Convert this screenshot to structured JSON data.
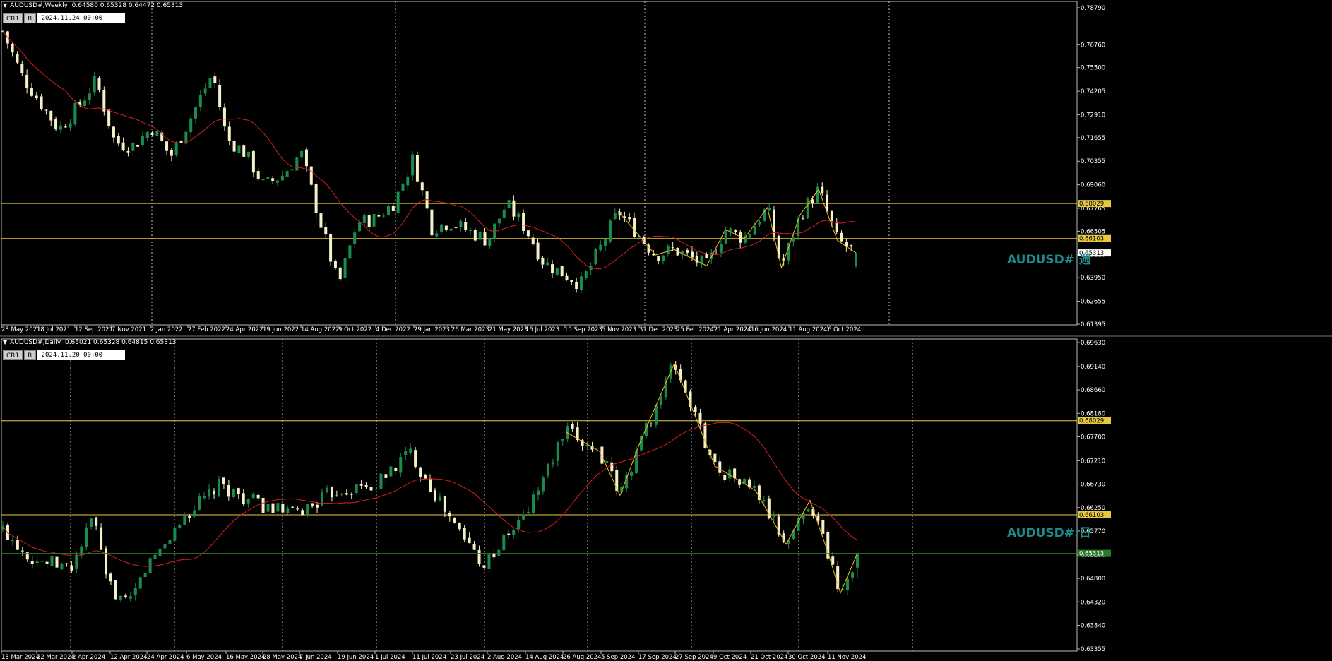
{
  "colors": {
    "background": "#000000",
    "bull_candle": "#1a8c4e",
    "bear_candle": "#f5f0c8",
    "ma_line": "#d42020",
    "zigzag": "#f0c020",
    "level_line": "#e8c840",
    "current_line": "#2a7a2a",
    "grid": "#c8c8c8",
    "watermark": "#1f8a8a"
  },
  "panes": [
    {
      "header": "AUDUSD#,Weekly  0.64580 0.65328 0.64472 0.65313",
      "buttons": [
        "CR1",
        "R"
      ],
      "date_box": "2024.11.24 00:00",
      "watermark": "AUDUSD#:週"
    },
    {
      "header": "AUDUSD#,Daily  0.65021 0.65328 0.64815 0.65313",
      "buttons": [
        "CR1",
        "R"
      ],
      "date_box": "2024.11.20 00:00",
      "watermark": "AUDUSD#:日"
    }
  ],
  "chart_data": [
    {
      "type": "candlestick",
      "timeframe": "Weekly",
      "symbol": "AUDUSD#",
      "ohlc_last": {
        "open": 0.6458,
        "high": 0.65328,
        "low": 0.64472,
        "close": 0.65313
      },
      "ylim": [
        0.61395,
        0.7879
      ],
      "y_ticks": [
        "0.78790",
        "0.76760",
        "0.75500",
        "0.74205",
        "0.72910",
        "0.71655",
        "0.70355",
        "0.69060",
        "0.67765",
        "0.66505",
        "0.65210",
        "0.63950",
        "0.62655",
        "0.61395"
      ],
      "x_ticks": [
        "23 May 2021",
        "18 Jul 2021",
        "12 Sep 2021",
        "7 Nov 2021",
        "2 Jan 2022",
        "27 Feb 2022",
        "24 Apr 2022",
        "19 Jun 2022",
        "14 Aug 2022",
        "9 Oct 2022",
        "4 Dec 2022",
        "29 Jan 2023",
        "26 Mar 2023",
        "21 May 2023",
        "16 Jul 2023",
        "10 Sep 2023",
        "5 Nov 2023",
        "31 Dec 2023",
        "25 Feb 2024",
        "21 Apr 2024",
        "16 Jun 2024",
        "11 Aug 2024",
        "6 Oct 2024"
      ],
      "levels": [
        {
          "label": "0.68029",
          "value": 0.68029
        },
        {
          "label": "0.66103",
          "value": 0.66103
        }
      ],
      "current_price": {
        "label": "0.65313",
        "value": 0.65313
      },
      "close_path": [
        {
          "date": "2021-05-23",
          "value": 0.775
        },
        {
          "date": "2021-06-20",
          "value": 0.751
        },
        {
          "date": "2021-07-18",
          "value": 0.736
        },
        {
          "date": "2021-08-15",
          "value": 0.721
        },
        {
          "date": "2021-09-12",
          "value": 0.733
        },
        {
          "date": "2021-10-10",
          "value": 0.748
        },
        {
          "date": "2021-11-07",
          "value": 0.714
        },
        {
          "date": "2021-12-05",
          "value": 0.712
        },
        {
          "date": "2022-01-02",
          "value": 0.722
        },
        {
          "date": "2022-01-30",
          "value": 0.706
        },
        {
          "date": "2022-02-27",
          "value": 0.726
        },
        {
          "date": "2022-04-03",
          "value": 0.752
        },
        {
          "date": "2022-04-24",
          "value": 0.716
        },
        {
          "date": "2022-05-22",
          "value": 0.708
        },
        {
          "date": "2022-06-19",
          "value": 0.69
        },
        {
          "date": "2022-07-17",
          "value": 0.696
        },
        {
          "date": "2022-08-14",
          "value": 0.708
        },
        {
          "date": "2022-09-11",
          "value": 0.671
        },
        {
          "date": "2022-10-09",
          "value": 0.635
        },
        {
          "date": "2022-11-06",
          "value": 0.67
        },
        {
          "date": "2022-12-04",
          "value": 0.672
        },
        {
          "date": "2023-01-01",
          "value": 0.681
        },
        {
          "date": "2023-01-29",
          "value": 0.705
        },
        {
          "date": "2023-02-26",
          "value": 0.667
        },
        {
          "date": "2023-03-26",
          "value": 0.67
        },
        {
          "date": "2023-04-23",
          "value": 0.665
        },
        {
          "date": "2023-05-21",
          "value": 0.66
        },
        {
          "date": "2023-06-18",
          "value": 0.68
        },
        {
          "date": "2023-07-16",
          "value": 0.667
        },
        {
          "date": "2023-08-13",
          "value": 0.648
        },
        {
          "date": "2023-09-10",
          "value": 0.642
        },
        {
          "date": "2023-10-08",
          "value": 0.636
        },
        {
          "date": "2023-11-05",
          "value": 0.655
        },
        {
          "date": "2023-12-03",
          "value": 0.676
        },
        {
          "date": "2023-12-31",
          "value": 0.664
        },
        {
          "date": "2024-01-28",
          "value": 0.652
        },
        {
          "date": "2024-02-25",
          "value": 0.655
        },
        {
          "date": "2024-04-14",
          "value": 0.646
        },
        {
          "date": "2024-05-12",
          "value": 0.666
        },
        {
          "date": "2024-06-09",
          "value": 0.661
        },
        {
          "date": "2024-07-14",
          "value": 0.678
        },
        {
          "date": "2024-08-04",
          "value": 0.645
        },
        {
          "date": "2024-09-01",
          "value": 0.674
        },
        {
          "date": "2024-09-29",
          "value": 0.688
        },
        {
          "date": "2024-10-27",
          "value": 0.66
        },
        {
          "date": "2024-11-24",
          "value": 0.65313
        }
      ]
    },
    {
      "type": "candlestick",
      "timeframe": "Daily",
      "symbol": "AUDUSD#",
      "ohlc_last": {
        "open": 0.65021,
        "high": 0.65328,
        "low": 0.64815,
        "close": 0.65313
      },
      "ylim": [
        0.63355,
        0.6963
      ],
      "y_ticks": [
        "0.69630",
        "0.69140",
        "0.68660",
        "0.68180",
        "0.67700",
        "0.67210",
        "0.66730",
        "0.66250",
        "0.65770",
        "0.65280",
        "0.64800",
        "0.64320",
        "0.63840",
        "0.63355"
      ],
      "x_ticks": [
        "13 Mar 2024",
        "22 Mar 2024",
        "2 Apr 2024",
        "12 Apr 2024",
        "24 Apr 2024",
        "6 May 2024",
        "16 May 2024",
        "28 May 2024",
        "7 Jun 2024",
        "19 Jun 2024",
        "1 Jul 2024",
        "11 Jul 2024",
        "23 Jul 2024",
        "2 Aug 2024",
        "14 Aug 2024",
        "26 Aug 2024",
        "5 Sep 2024",
        "17 Sep 2024",
        "27 Sep 2024",
        "9 Oct 2024",
        "21 Oct 2024",
        "30 Oct 2024",
        "11 Nov 2024"
      ],
      "levels": [
        {
          "label": "0.68029",
          "value": 0.68029
        },
        {
          "label": "0.66103",
          "value": 0.66103
        }
      ],
      "current_price": {
        "label": "0.65313",
        "value": 0.65313
      },
      "close_path": [
        {
          "date": "2024-03-13",
          "value": 0.658
        },
        {
          "date": "2024-03-22",
          "value": 0.652
        },
        {
          "date": "2024-04-02",
          "value": 0.65
        },
        {
          "date": "2024-04-09",
          "value": 0.661
        },
        {
          "date": "2024-04-12",
          "value": 0.648
        },
        {
          "date": "2024-04-19",
          "value": 0.642
        },
        {
          "date": "2024-04-24",
          "value": 0.65
        },
        {
          "date": "2024-05-06",
          "value": 0.661
        },
        {
          "date": "2024-05-16",
          "value": 0.667
        },
        {
          "date": "2024-05-28",
          "value": 0.663
        },
        {
          "date": "2024-06-07",
          "value": 0.661
        },
        {
          "date": "2024-06-19",
          "value": 0.666
        },
        {
          "date": "2024-07-01",
          "value": 0.667
        },
        {
          "date": "2024-07-11",
          "value": 0.674
        },
        {
          "date": "2024-07-23",
          "value": 0.66
        },
        {
          "date": "2024-08-02",
          "value": 0.651
        },
        {
          "date": "2024-08-14",
          "value": 0.661
        },
        {
          "date": "2024-08-26",
          "value": 0.678
        },
        {
          "date": "2024-09-05",
          "value": 0.674
        },
        {
          "date": "2024-09-11",
          "value": 0.665
        },
        {
          "date": "2024-09-17",
          "value": 0.676
        },
        {
          "date": "2024-09-27",
          "value": 0.692
        },
        {
          "date": "2024-10-09",
          "value": 0.671
        },
        {
          "date": "2024-10-21",
          "value": 0.666
        },
        {
          "date": "2024-10-30",
          "value": 0.655
        },
        {
          "date": "2024-11-06",
          "value": 0.664
        },
        {
          "date": "2024-11-11",
          "value": 0.654
        },
        {
          "date": "2024-11-15",
          "value": 0.645
        },
        {
          "date": "2024-11-20",
          "value": 0.65313
        }
      ]
    }
  ]
}
